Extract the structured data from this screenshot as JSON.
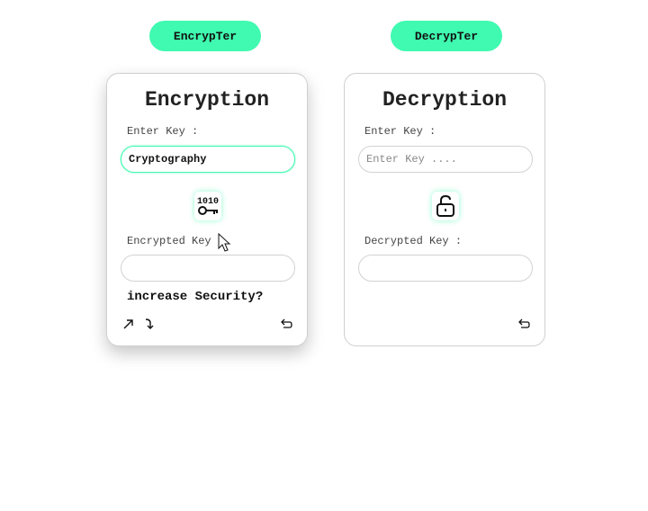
{
  "tabs": {
    "encrypter_label": "EncrypTer",
    "decrypter_label": "DecrypTer"
  },
  "encryption": {
    "title": "Encryption",
    "key_label": "Enter Key :",
    "key_value": "Cryptography",
    "center_icon": "binary-key-icon",
    "output_label": "Encrypted Key :",
    "output_value": "",
    "security_link": "increase Security?",
    "bottom_icons": [
      "arrow-up-right-icon",
      "arrow-curved-down-icon",
      "undo-icon"
    ]
  },
  "decryption": {
    "title": "Decryption",
    "key_label": "Enter Key :",
    "key_placeholder": "Enter Key ....",
    "center_icon": "unlock-icon",
    "output_label": "Decrypted Key :",
    "output_value": "",
    "bottom_icons": [
      "undo-icon"
    ]
  },
  "colors": {
    "accent": "#3ffab0",
    "border": "#cfcfcf",
    "text": "#222222"
  }
}
